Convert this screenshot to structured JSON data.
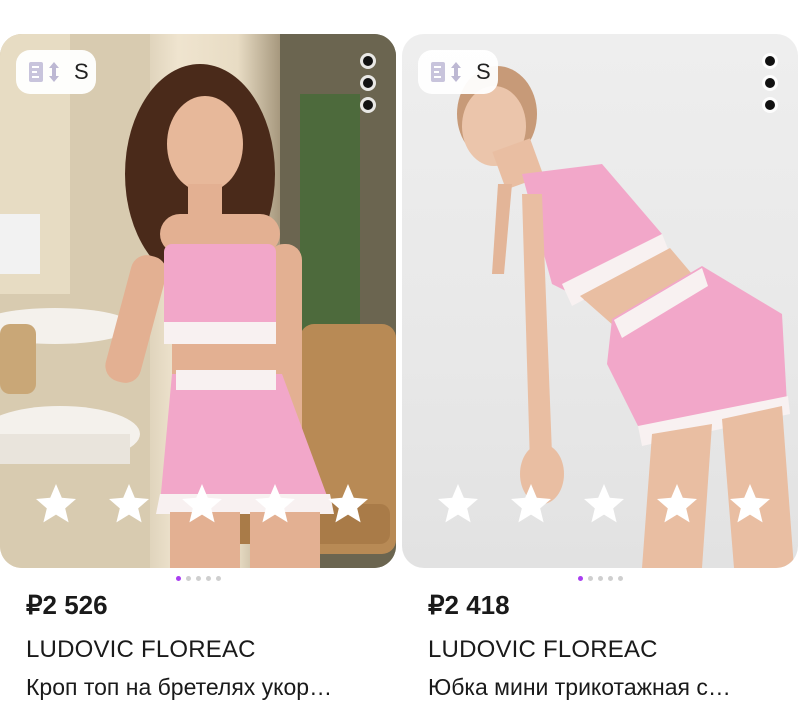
{
  "products": [
    {
      "size_label": "S",
      "price": "₽2 526",
      "brand": "LUDOVIC FLOREAC",
      "title": "Кроп топ на бретелях укор…",
      "photo_count": 5,
      "active_photo": 1,
      "rating_stars": 5
    },
    {
      "size_label": "S",
      "price": "₽2 418",
      "brand": "LUDOVIC FLOREAC",
      "title": "Юбка мини трикотажная с…",
      "photo_count": 5,
      "active_photo": 1,
      "rating_stars": 5
    }
  ],
  "colors": {
    "accent": "#a93ef0",
    "product_pink": "#f0a6c8",
    "text": "#1a1a1a"
  },
  "icons": {
    "size_badge": "size-measure-icon",
    "more": "more-vertical-icon",
    "rating": "star-icon"
  }
}
